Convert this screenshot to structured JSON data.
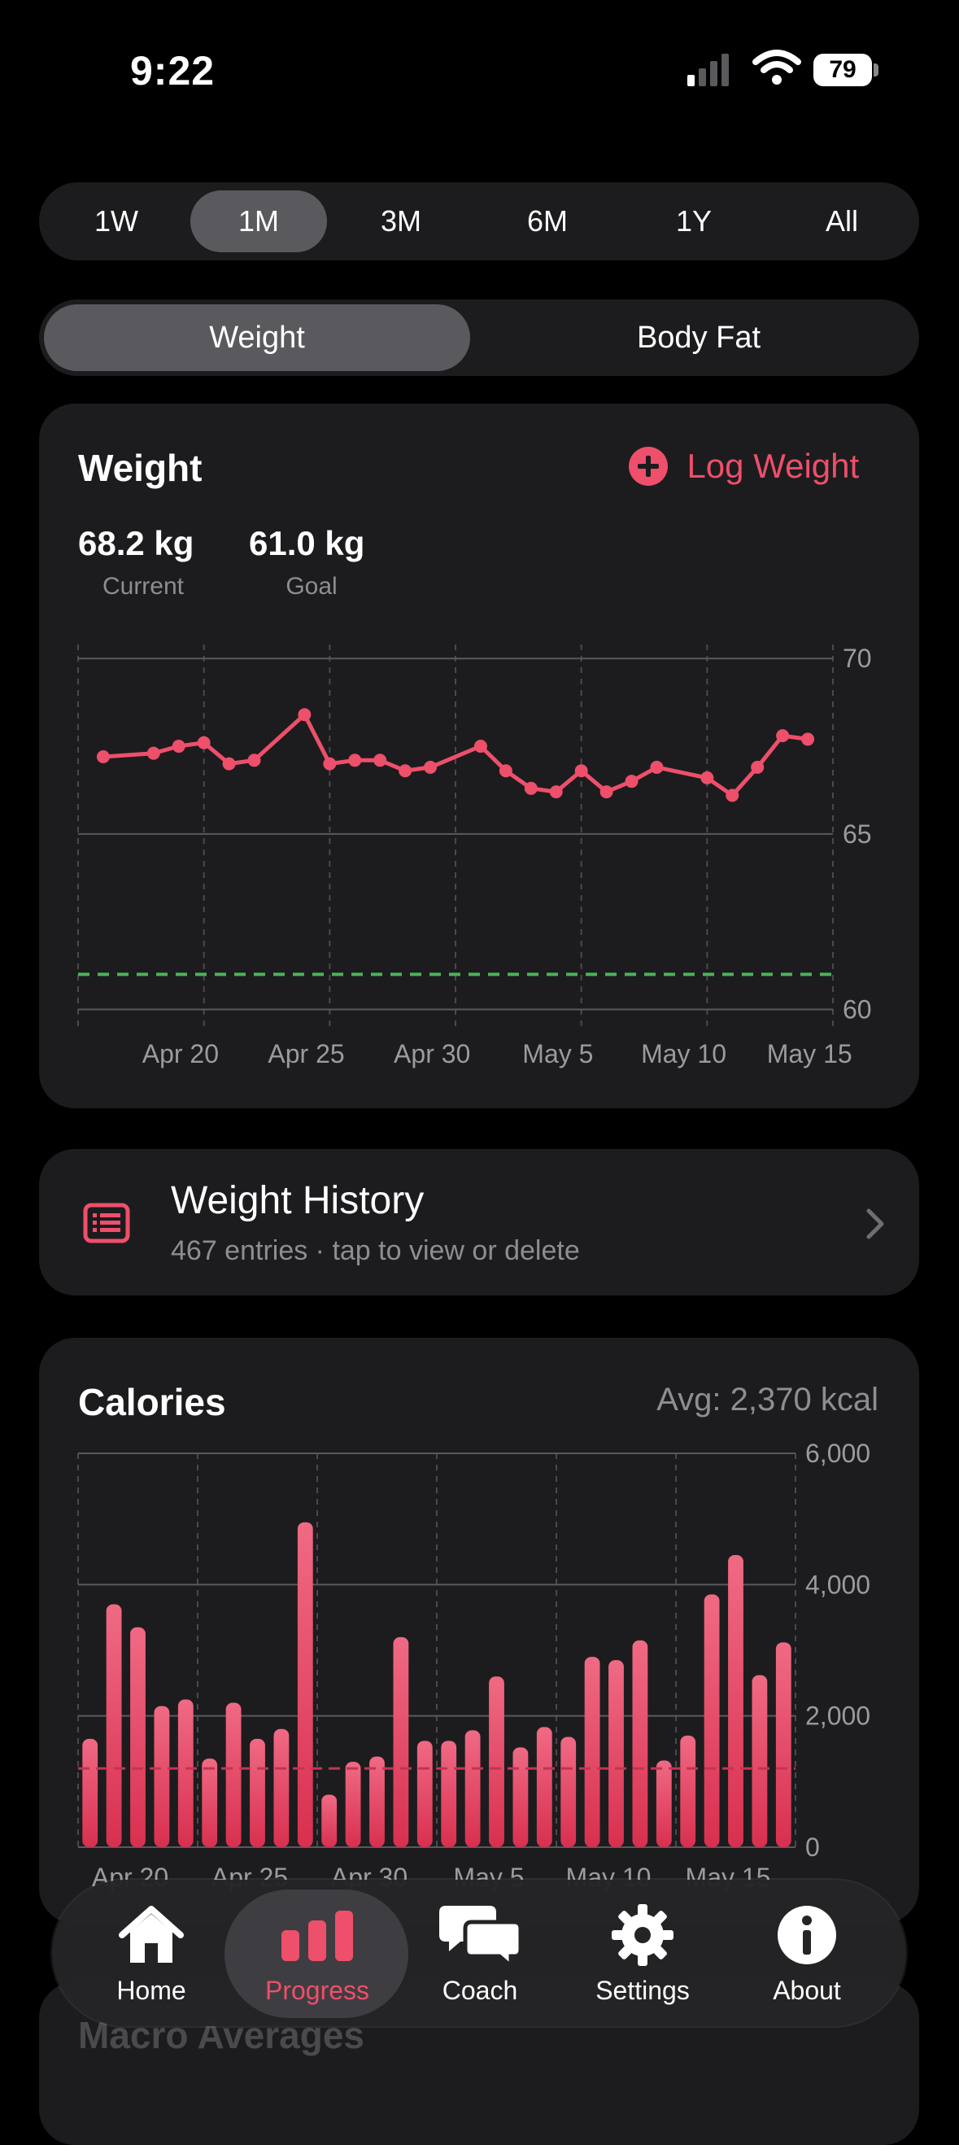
{
  "status": {
    "time": "9:22",
    "battery": "79"
  },
  "ranges": {
    "items": [
      "1W",
      "1M",
      "3M",
      "6M",
      "1Y",
      "All"
    ],
    "selected": "1M"
  },
  "metric_tabs": {
    "weight": "Weight",
    "body_fat": "Body Fat",
    "selected": "Weight"
  },
  "weight_card": {
    "title": "Weight",
    "log_label": "Log Weight",
    "current_value": "68.2 kg",
    "current_label": "Current",
    "goal_value": "61.0 kg",
    "goal_label": "Goal"
  },
  "history": {
    "title": "Weight History",
    "subtitle": "467 entries · tap to view or delete"
  },
  "calories_card": {
    "title": "Calories",
    "avg": "Avg: 2,370 kcal"
  },
  "macro_title": "Macro Averages",
  "tabbar": {
    "home": "Home",
    "progress": "Progress",
    "coach": "Coach",
    "settings": "Settings",
    "about": "About",
    "active": "Progress"
  },
  "colors": {
    "accent": "#ee4f6b",
    "goal_line": "#4cb25a",
    "card": "#1c1c1e"
  },
  "chart_data": [
    {
      "type": "line",
      "title": "Weight",
      "x_tick_labels": [
        "Apr 20",
        "Apr 25",
        "Apr 30",
        "May 5",
        "May 10",
        "May 15"
      ],
      "y_tick_labels": [
        "70",
        "65",
        "60"
      ],
      "ylim": [
        59.5,
        70.4
      ],
      "grid": true,
      "goal": 61.0,
      "series": [
        {
          "x": [
            "Apr 19",
            "Apr 21",
            "Apr 22",
            "Apr 23",
            "Apr 24",
            "Apr 25",
            "Apr 27",
            "Apr 28",
            "Apr 29",
            "Apr 30",
            "May 1",
            "May 2",
            "May 4",
            "May 5",
            "May 6",
            "May 7",
            "May 8",
            "May 9",
            "May 10",
            "May 11",
            "May 13",
            "May 14",
            "May 15",
            "May 16",
            "May 17"
          ],
          "values": [
            67.2,
            67.3,
            67.5,
            67.6,
            67.0,
            67.1,
            68.4,
            67.0,
            67.1,
            67.1,
            66.8,
            66.9,
            67.5,
            66.8,
            66.3,
            66.2,
            66.8,
            66.2,
            66.5,
            66.9,
            66.6,
            66.1,
            66.9,
            67.8,
            67.7
          ]
        }
      ]
    },
    {
      "type": "bar",
      "title": "Calories",
      "x_tick_labels": [
        "Apr 20",
        "Apr 25",
        "Apr 30",
        "May 5",
        "May 10",
        "May 15"
      ],
      "y_tick_labels": [
        "6,000",
        "4,000",
        "2,000",
        "0"
      ],
      "ylim": [
        0,
        6000
      ],
      "grid": true,
      "goal": 1200,
      "series": [
        {
          "values": [
            1650,
            3700,
            3350,
            2150,
            2250,
            1350,
            2200,
            1650,
            1800,
            4950,
            800,
            1300,
            1380,
            3200,
            1620,
            1620,
            1780,
            2600,
            1520,
            1830,
            1680,
            2900,
            2850,
            3150,
            1320,
            1700,
            3850,
            4450,
            2620,
            3120
          ]
        }
      ]
    }
  ]
}
